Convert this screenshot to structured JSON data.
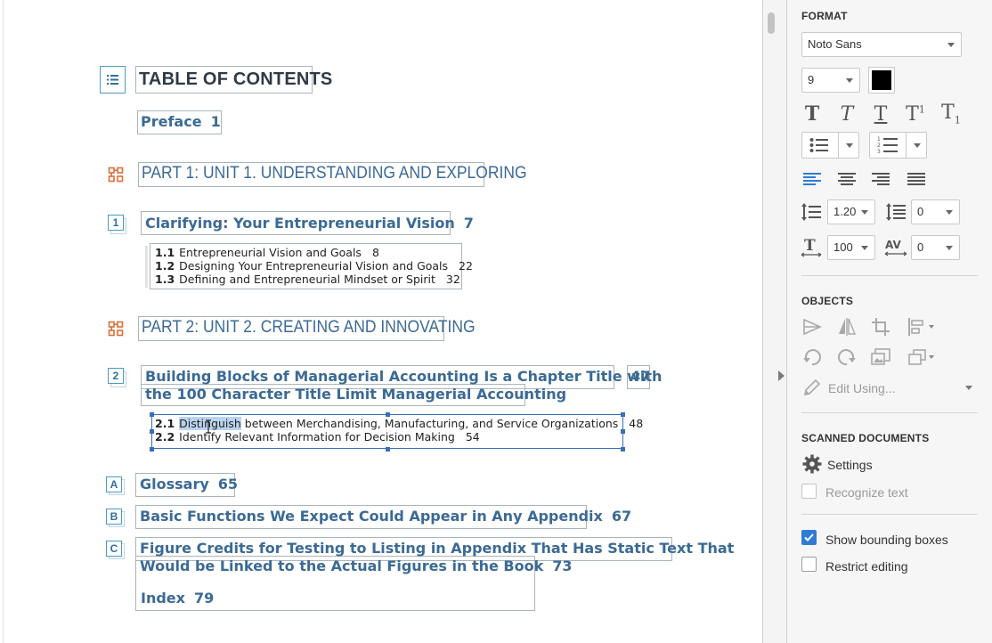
{
  "toc": {
    "title": "TABLE OF CONTENTS",
    "preface": {
      "label": "Preface",
      "page": "1"
    },
    "parts": [
      {
        "label": "PART 1: UNIT 1. UNDERSTANDING AND EXPLORING"
      },
      {
        "label": "PART 2: UNIT 2. CREATING AND INNOVATING"
      }
    ],
    "chapters": [
      {
        "badge": "1",
        "title": "Clarifying: Your Entrepreneurial Vision",
        "page": "7",
        "sections": [
          {
            "num": "1.1",
            "title": "Entrepreneurial Vision and Goals",
            "page": "8"
          },
          {
            "num": "1.2",
            "title": "Designing Your Entrepreneurial Vision and Goals",
            "page": "22"
          },
          {
            "num": "1.3",
            "title": "Defining and Entrepreneurial Mindset or Spirit",
            "page": "32"
          }
        ]
      },
      {
        "badge": "2",
        "title_line1": "Building Blocks of Managerial Accounting Is a Chapter Title with",
        "title_line2": "the 100 Character Title Limit Managerial Accounting",
        "page": "47",
        "sections": [
          {
            "num": "2.1",
            "title_selected": "Distinguish",
            "title_rest": " between Merchandising, Manufacturing, and Service Organizations",
            "page": "48"
          },
          {
            "num": "2.2",
            "title": "Identify Relevant Information for Decision Making",
            "page": "54"
          }
        ]
      }
    ],
    "appendices": [
      {
        "badge": "A",
        "title": "Glossary",
        "page": "65"
      },
      {
        "badge": "B",
        "title": "Basic Functions We Expect Could Appear in Any Appendix",
        "page": "67"
      },
      {
        "badge": "C",
        "title_line1": "Figure Credits for Testing to Listing in Appendix That Has Static Text That",
        "title_line2": "Would be Linked to the Actual Figures in the Book",
        "page": "73"
      }
    ],
    "index": {
      "label": "Index",
      "page": "79"
    }
  },
  "panel": {
    "format": {
      "heading": "FORMAT",
      "font_family": "Noto Sans",
      "font_size": "9",
      "color": "#000000",
      "line_spacing": "1.20",
      "para_spacing": "0",
      "char_scale": "100",
      "char_spacing": "0"
    },
    "objects": {
      "heading": "OBJECTS",
      "edit_using": "Edit Using..."
    },
    "scanned": {
      "heading": "SCANNED DOCUMENTS",
      "settings": "Settings",
      "recognize_text": "Recognize text"
    },
    "show_bounding_boxes": "Show bounding boxes",
    "restrict_editing": "Restrict editing",
    "colors": {
      "accent": "#2f7bd6",
      "heading_blue": "#3b6a95",
      "badge_blue": "#4a9bc4",
      "part_icon": "#d9703a"
    }
  }
}
